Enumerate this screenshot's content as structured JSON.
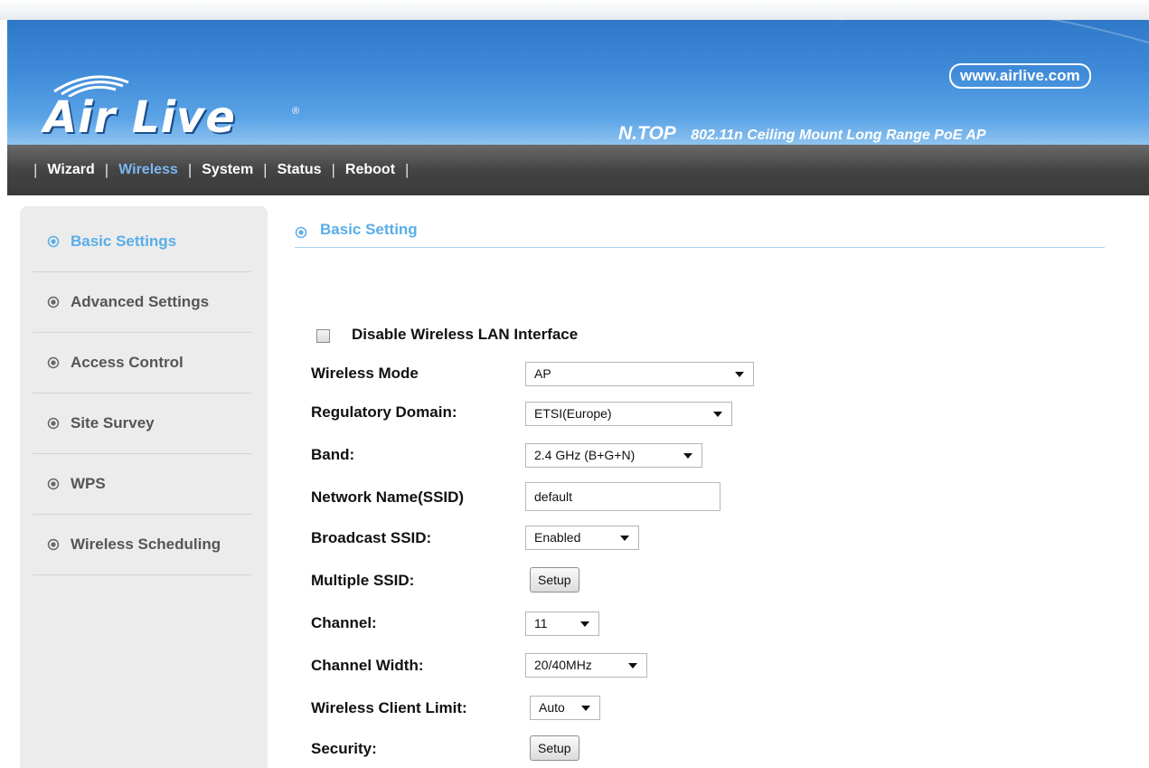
{
  "header": {
    "logo_text": "Air Live",
    "logo_mark": "®",
    "url": "www.airlive.com",
    "model": "N.TOP",
    "description": "802.11n Ceiling Mount Long Range PoE AP"
  },
  "nav": {
    "items": [
      {
        "label": "Wizard"
      },
      {
        "label": "Wireless",
        "active": true
      },
      {
        "label": "System"
      },
      {
        "label": "Status"
      },
      {
        "label": "Reboot"
      }
    ],
    "separator": "|"
  },
  "sidebar": {
    "items": [
      {
        "label": "Basic Settings",
        "active": true
      },
      {
        "label": "Advanced Settings"
      },
      {
        "label": "Access Control"
      },
      {
        "label": "Site Survey"
      },
      {
        "label": "WPS"
      },
      {
        "label": "Wireless Scheduling"
      }
    ]
  },
  "main": {
    "title": "Basic Setting",
    "disable_wlan": {
      "label": "Disable Wireless LAN Interface",
      "checked": false
    },
    "fields": {
      "wireless_mode": {
        "label": "Wireless Mode",
        "value": "AP"
      },
      "regulatory_domain": {
        "label": "Regulatory Domain:",
        "value": "ETSI(Europe)"
      },
      "band": {
        "label": "Band:",
        "value": "2.4 GHz (B+G+N)"
      },
      "ssid": {
        "label": "Network Name(SSID)",
        "value": "default"
      },
      "broadcast_ssid": {
        "label": "Broadcast SSID:",
        "value": "Enabled"
      },
      "multiple_ssid": {
        "label": "Multiple SSID:",
        "button": "Setup"
      },
      "channel": {
        "label": "Channel:",
        "value": "11"
      },
      "channel_width": {
        "label": "Channel Width:",
        "value": "20/40MHz"
      },
      "client_limit": {
        "label": "Wireless Client Limit:",
        "value": "Auto"
      },
      "security": {
        "label": "Security:",
        "button": "Setup"
      }
    }
  },
  "colors": {
    "accent": "#5aaee8",
    "nav_bg": "#444444",
    "banner": "#3e8ad8"
  }
}
